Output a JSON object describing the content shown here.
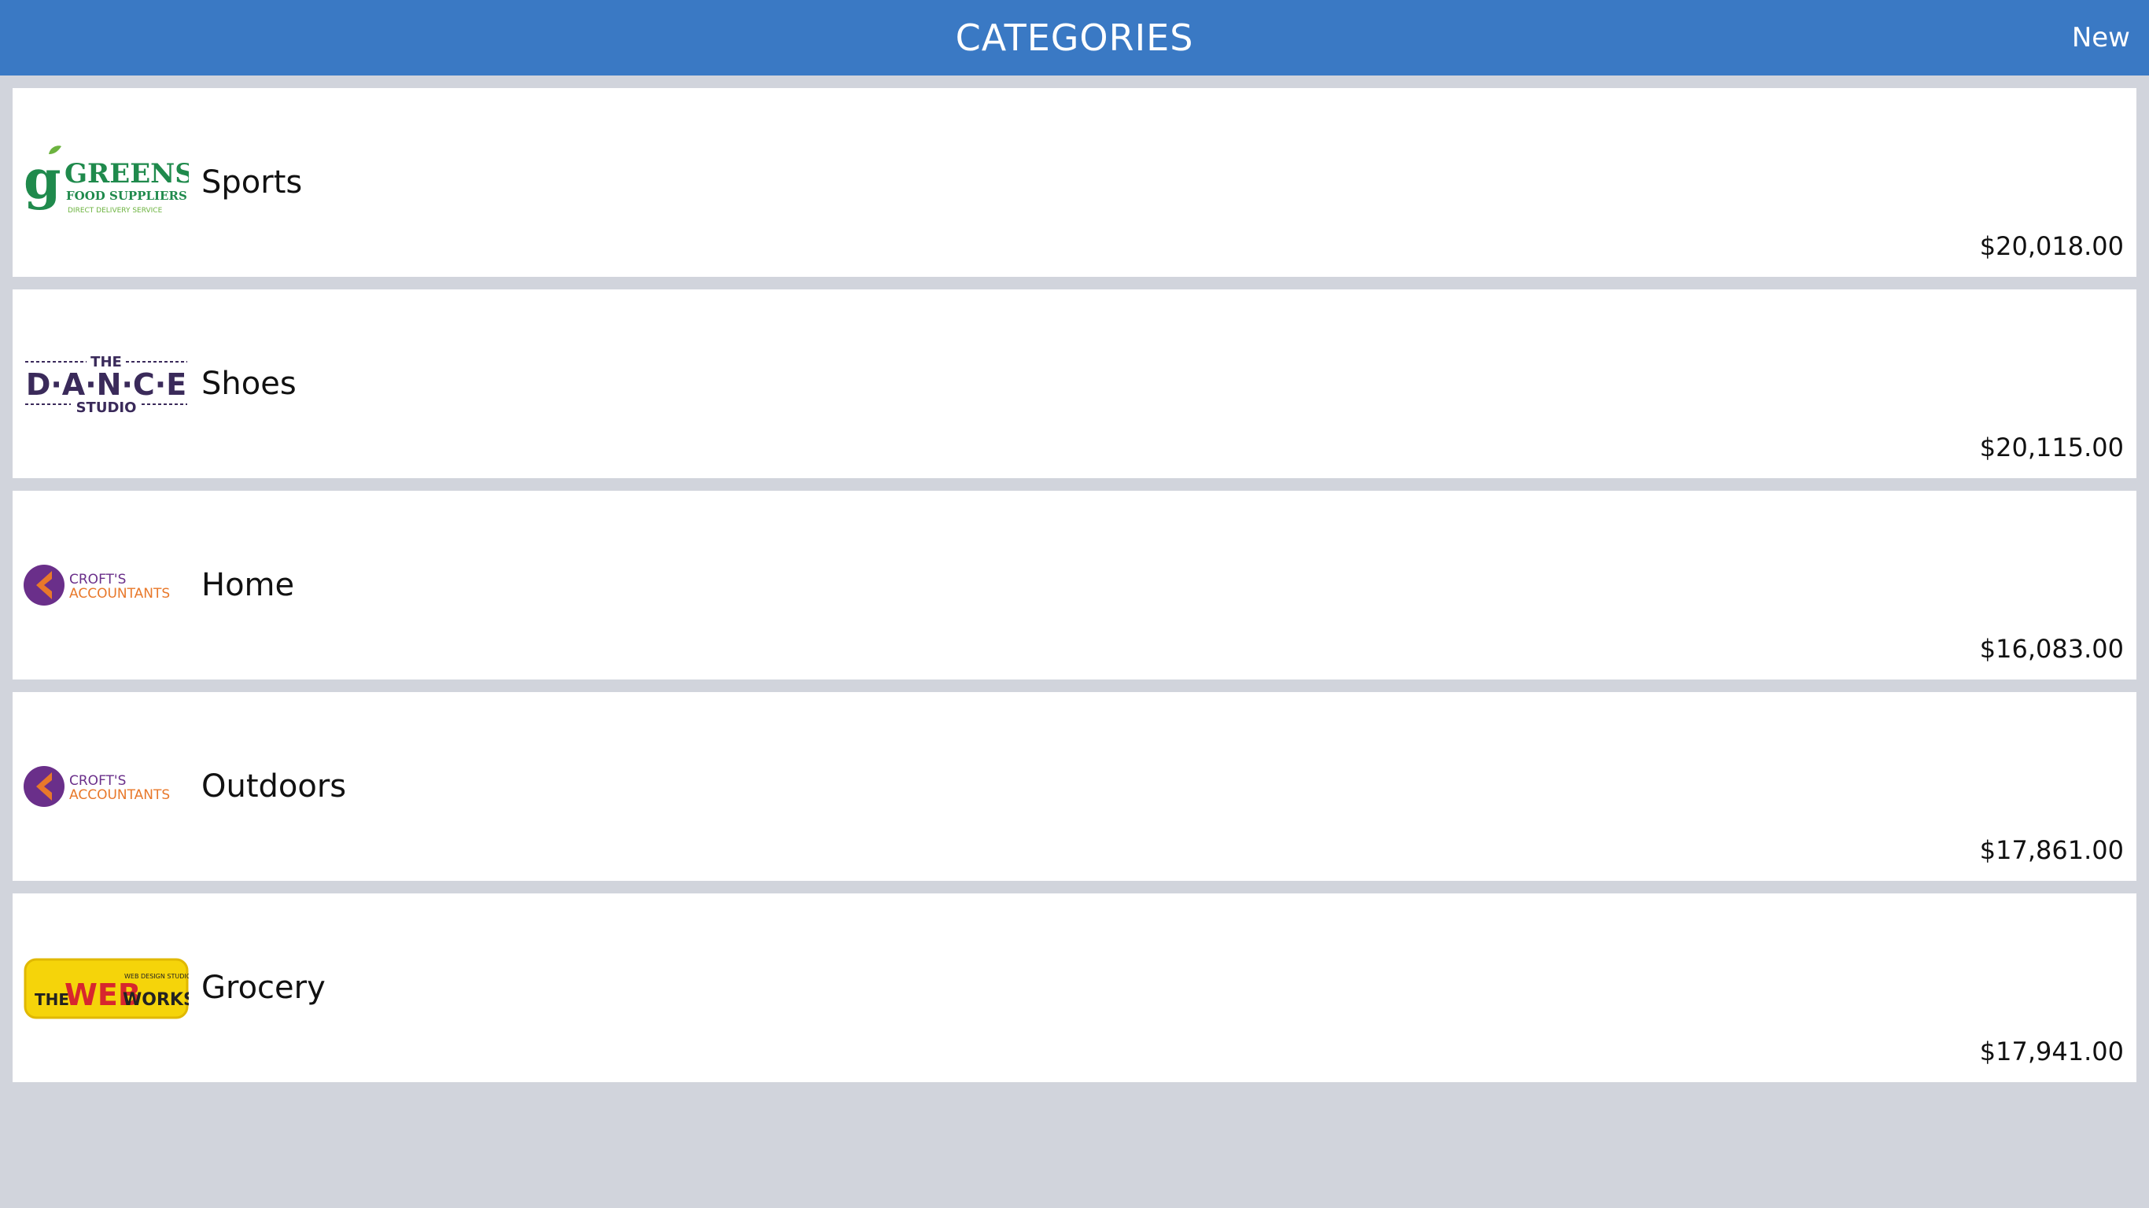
{
  "header": {
    "title": "CATEGORIES",
    "new_label": "New"
  },
  "colors": {
    "header": "#3a79c4",
    "background": "#d1d4dc",
    "row": "#ffffff"
  },
  "categories": [
    {
      "name": "Sports",
      "amount": "$20,018.00",
      "logo": "greens-food-suppliers",
      "logo_text": {
        "main": "GREENS",
        "sub": "FOOD SUPPLIERS",
        "tag": "DIRECT DELIVERY SERVICE"
      }
    },
    {
      "name": "Shoes",
      "amount": "$20,115.00",
      "logo": "the-dance-studio",
      "logo_text": {
        "top": "THE",
        "main": "D·A·N·C·E",
        "bottom": "STUDIO"
      }
    },
    {
      "name": "Home",
      "amount": "$16,083.00",
      "logo": "crofts-accountants",
      "logo_text": {
        "top": "CROFT'S",
        "bottom": "ACCOUNTANTS"
      }
    },
    {
      "name": "Outdoors",
      "amount": "$17,861.00",
      "logo": "crofts-accountants",
      "logo_text": {
        "top": "CROFT'S",
        "bottom": "ACCOUNTANTS"
      }
    },
    {
      "name": "Grocery",
      "amount": "$17,941.00",
      "logo": "the-web-works",
      "logo_text": {
        "the": "THE",
        "web": "WEB",
        "works": "WORKS",
        "tag": "WEB DESIGN STUDIO"
      }
    }
  ]
}
